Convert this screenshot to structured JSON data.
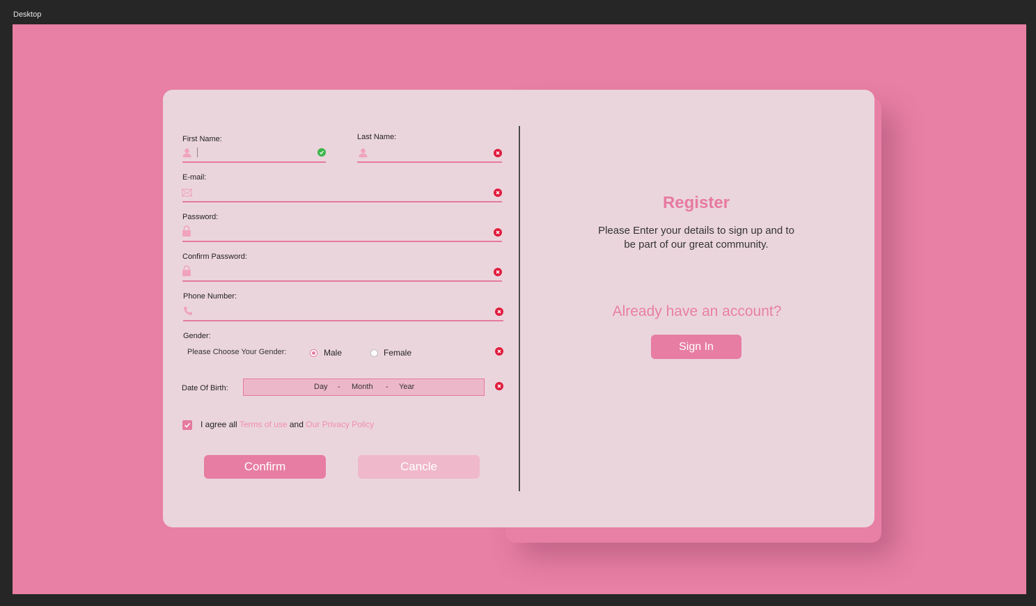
{
  "frame": {
    "title": "Desktop"
  },
  "form": {
    "first_name": {
      "label": "First Name:",
      "status": "valid"
    },
    "last_name": {
      "label": "Last Name:",
      "status": "error"
    },
    "email": {
      "label": "E-mail:",
      "status": "error"
    },
    "password": {
      "label": "Password:",
      "status": "error"
    },
    "confirm_password": {
      "label": "Confirm Password:",
      "status": "error"
    },
    "phone": {
      "label": "Phone Number:",
      "status": "error"
    },
    "gender": {
      "label": "Gender:",
      "prompt": "Please Choose Your Gender:",
      "options": [
        "Male",
        "Female"
      ],
      "selected": "Male",
      "status": "error"
    },
    "dob": {
      "label": "Date Of Birth:",
      "day": "Day",
      "month": "Month",
      "year": "Year",
      "separator": "-",
      "status": "error"
    },
    "agree": {
      "checked": true,
      "prefix": "I agree all",
      "terms_link": "Terms of use",
      "conjunction": "and",
      "privacy_link": "Our Privacy Policy"
    },
    "confirm_label": "Confirm",
    "cancel_label": "Cancle"
  },
  "side": {
    "title": "Register",
    "description": "Please Enter your details to sign up and to be part of our great community.",
    "already": "Already have an account?",
    "signin_label": "Sign In"
  },
  "colors": {
    "background": "#e87fa4",
    "card": "#ebd5dd",
    "accent": "#e77da2",
    "error": "#e01b3c",
    "success": "#3bb54a"
  },
  "icons": [
    "user-icon",
    "envelope-icon",
    "lock-icon",
    "phone-icon",
    "check-icon",
    "error-icon"
  ]
}
